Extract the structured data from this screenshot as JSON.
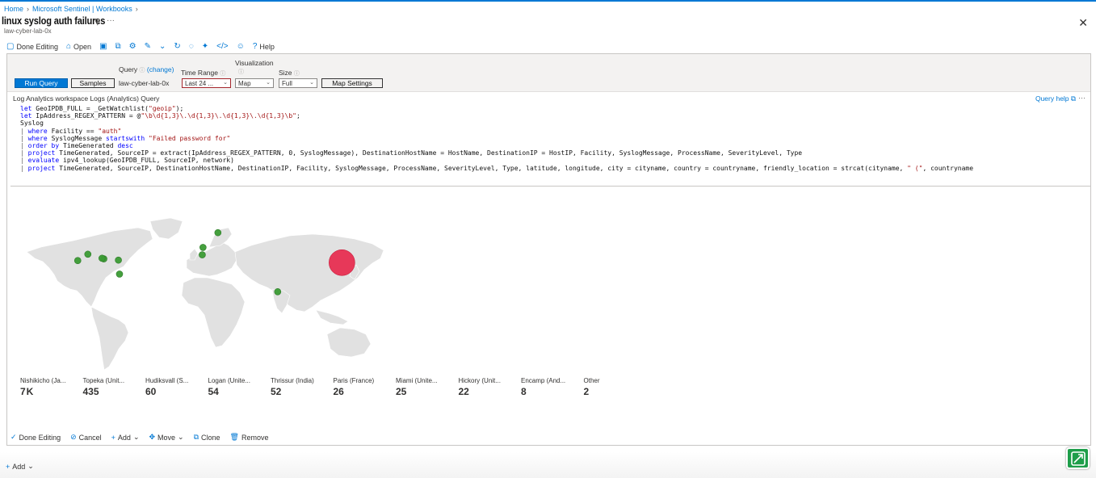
{
  "breadcrumb": {
    "home": "Home",
    "sentinel": "Microsoft Sentinel | Workbooks"
  },
  "title": "linux syslog auth failures",
  "subtitle": "law-cyber-lab-0x",
  "toolbar": {
    "done_editing": "Done Editing",
    "open": "Open",
    "help": "Help"
  },
  "params": {
    "query_label": "Query",
    "change_link": "(change)",
    "workspace": "law-cyber-lab-0x",
    "time_range_label": "Time Range",
    "time_range_value": "Last 24 ...",
    "visualization_label": "Visualization",
    "visualization_value": "Map",
    "size_label": "Size",
    "size_value": "Full",
    "run_query": "Run Query",
    "samples": "Samples",
    "map_settings": "Map Settings"
  },
  "query_section": {
    "header": "Log Analytics workspace Logs (Analytics) Query",
    "help": "Query help"
  },
  "code_lines": [
    "let GeoIPDB_FULL = _GetWatchlist(\"geoip\");",
    "let IpAddress_REGEX_PATTERN = @\"\\b\\d{1,3}\\.\\d{1,3}\\.\\d{1,3}\\.\\d{1,3}\\b\";",
    "Syslog",
    "| where Facility == \"auth\"",
    "| where SyslogMessage startswith \"Failed password for\"",
    "| order by TimeGenerated desc",
    "| project TimeGenerated, SourceIP = extract(IpAddress_REGEX_PATTERN, 0, SyslogMessage), DestinationHostName = HostName, DestinationIP = HostIP, Facility, SyslogMessage, ProcessName, SeverityLevel, Type",
    "| evaluate ipv4_lookup(GeoIPDB_FULL, SourceIP, network)",
    "| project TimeGenerated, SourceIP, DestinationHostName, DestinationIP, Facility, SyslogMessage, ProcessName, SeverityLevel, Type, latitude, longitude, city = cityname, country = countryname, friendly_location = strcat(cityname, \" (\", countryname"
  ],
  "map_points": [
    {
      "name": "Nishikicho",
      "lon": 139.7,
      "lat": 35.7,
      "major": true
    },
    {
      "name": "Topeka",
      "lon": -95.7,
      "lat": 39.0
    },
    {
      "name": "Topeka-2",
      "lon": -97.5,
      "lat": 39.5
    },
    {
      "name": "US-West",
      "lon": -121.5,
      "lat": 37.5
    },
    {
      "name": "US-NW",
      "lon": -111.5,
      "lat": 43.0
    },
    {
      "name": "Logan",
      "lon": -81.3,
      "lat": 37.9
    },
    {
      "name": "Miami",
      "lon": -80.2,
      "lat": 25.8
    },
    {
      "name": "Hudiksvall",
      "lon": 17.1,
      "lat": 61.7
    },
    {
      "name": "Paris",
      "lon": 2.35,
      "lat": 48.9
    },
    {
      "name": "Encamp",
      "lon": 1.6,
      "lat": 42.5
    },
    {
      "name": "Thrissur",
      "lon": 76.2,
      "lat": 10.5
    }
  ],
  "legend": [
    {
      "name": "Nishikicho (Ja...",
      "value": "7 K"
    },
    {
      "name": "Topeka (Unit...",
      "value": "435"
    },
    {
      "name": "Hudiksvall (S...",
      "value": "60"
    },
    {
      "name": "Logan (Unite...",
      "value": "54"
    },
    {
      "name": "Thrissur (India)",
      "value": "52"
    },
    {
      "name": "Paris (France)",
      "value": "26"
    },
    {
      "name": "Miami (Unite...",
      "value": "25"
    },
    {
      "name": "Hickory (Unit...",
      "value": "22"
    },
    {
      "name": "Encamp (And...",
      "value": "8"
    },
    {
      "name": "Other",
      "value": "2"
    }
  ],
  "footer": {
    "done_editing": "Done Editing",
    "cancel": "Cancel",
    "add": "Add",
    "move": "Move",
    "clone": "Clone",
    "remove": "Remove"
  },
  "add_bottom": "Add",
  "colors": {
    "accent": "#0078d4",
    "minor_point": "#3b9b34",
    "major_point": "#e8264a",
    "land": "#e1e1e1"
  }
}
